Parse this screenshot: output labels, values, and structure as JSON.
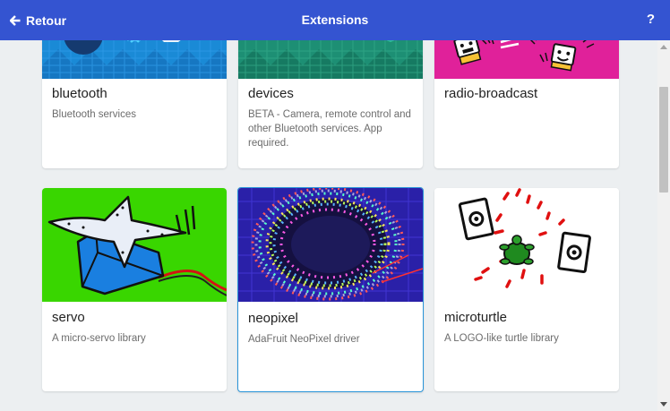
{
  "header": {
    "back_label": "Retour",
    "title": "Extensions",
    "help_label": "?",
    "background": "#3454d1"
  },
  "extensions": [
    {
      "name": "bluetooth",
      "description": "Bluetooth services",
      "image_icon": "bluetooth-thumbnail-icon"
    },
    {
      "name": "devices",
      "description": "BETA - Camera, remote control and other Bluetooth services. App required.",
      "image_icon": "devices-thumbnail-icon"
    },
    {
      "name": "radio-broadcast",
      "description": "",
      "image_icon": "radio-broadcast-thumbnail-icon"
    },
    {
      "name": "servo",
      "description": "A micro-servo library",
      "image_icon": "servo-thumbnail-icon"
    },
    {
      "name": "neopixel",
      "description": "AdaFruit NeoPixel driver",
      "image_icon": "neopixel-thumbnail-icon",
      "selected": true
    },
    {
      "name": "microturtle",
      "description": "A LOGO-like turtle library",
      "image_icon": "microturtle-thumbnail-icon"
    }
  ],
  "colors": {
    "background": "#eceff1",
    "selected_border": "#2a95d9"
  }
}
